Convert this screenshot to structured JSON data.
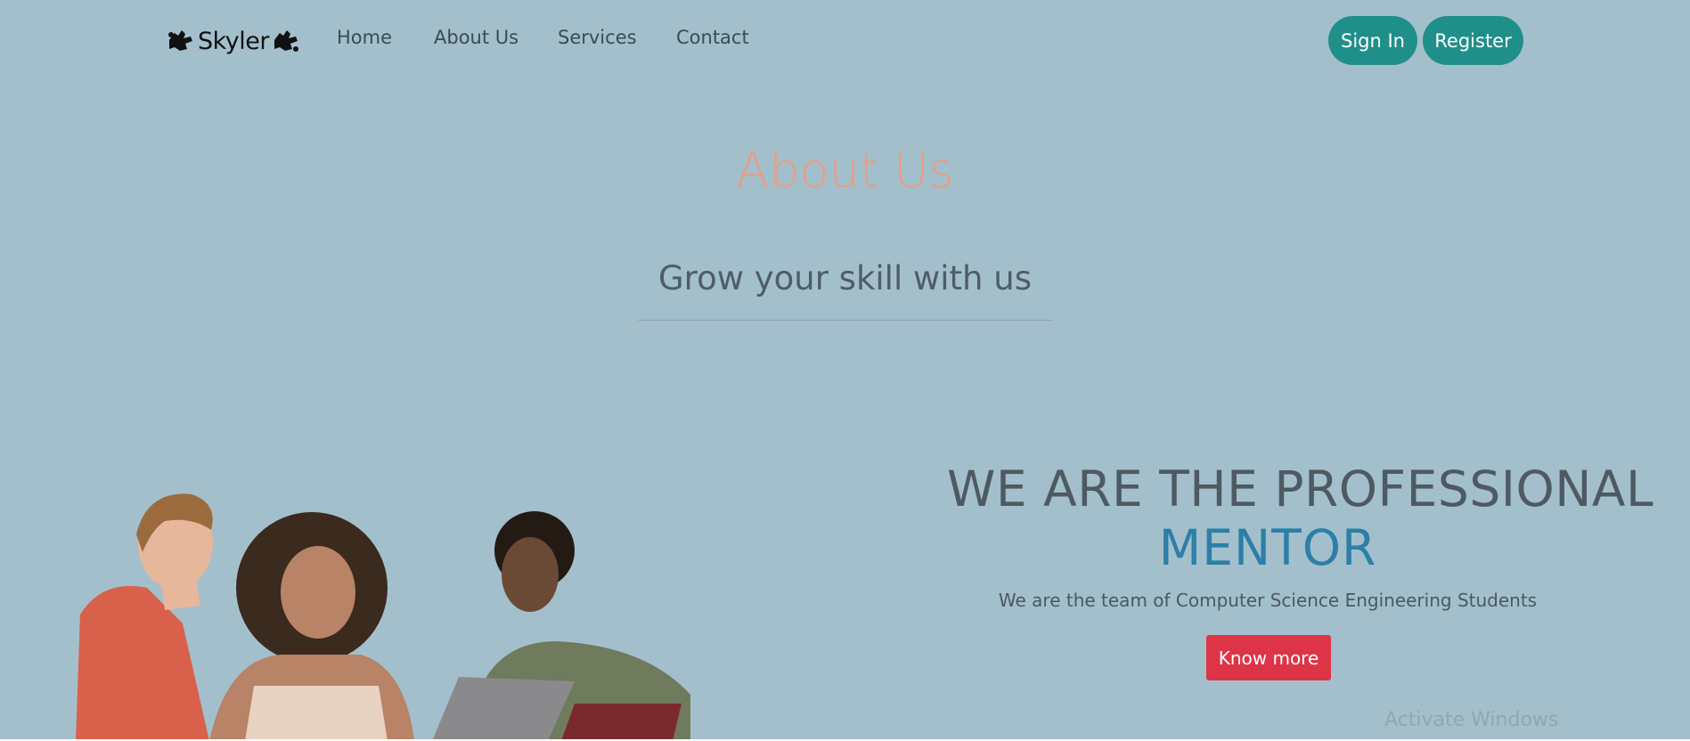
{
  "brand": {
    "name": "Skyler",
    "logo_icons": [
      "hand-sign-icon",
      "hand-sign-icon"
    ]
  },
  "nav": {
    "items": [
      "Home",
      "About Us",
      "Services",
      "Contact"
    ],
    "sign_in": "Sign In",
    "register": "Register"
  },
  "about": {
    "title": "About Us",
    "subtitle": "Grow your skill with us"
  },
  "hero": {
    "line1": "WE ARE THE PROFESSIONAL",
    "line2": "MENTOR",
    "description": "We are the team of Computer Science Engineering Students",
    "cta": "Know more",
    "image": "students-with-laptop"
  },
  "system": {
    "watermark": "Activate Windows"
  },
  "colors": {
    "background": "#a3bfcc",
    "accent_teal": "#1f9089",
    "title_salmon": "#e89e86",
    "mentor_blue": "#2c7fa8",
    "cta_red": "#de3447"
  }
}
